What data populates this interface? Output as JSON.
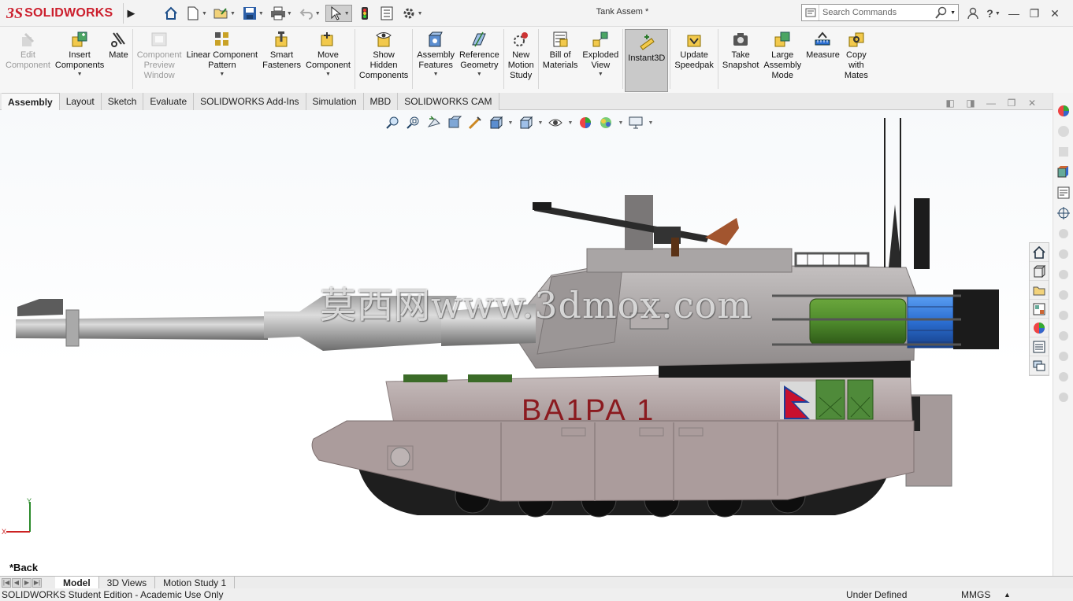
{
  "titlebar": {
    "logo_ds": "3S",
    "logo_text": "SOLIDWORKS",
    "document_title": "Tank Assem *",
    "search_placeholder": "Search Commands"
  },
  "commands": [
    {
      "id": "edit-component",
      "label": "Edit\nComponent",
      "disabled": true,
      "dropdown": false
    },
    {
      "id": "insert-components",
      "label": "Insert\nComponents",
      "disabled": false,
      "dropdown": true
    },
    {
      "id": "mate",
      "label": "Mate",
      "disabled": false,
      "dropdown": false
    },
    {
      "id": "component-preview-window",
      "label": "Component\nPreview\nWindow",
      "disabled": true,
      "dropdown": false
    },
    {
      "id": "linear-component-pattern",
      "label": "Linear Component\nPattern",
      "disabled": false,
      "dropdown": true
    },
    {
      "id": "smart-fasteners",
      "label": "Smart\nFasteners",
      "disabled": false,
      "dropdown": false
    },
    {
      "id": "move-component",
      "label": "Move\nComponent",
      "disabled": false,
      "dropdown": true
    },
    {
      "id": "show-hidden-components",
      "label": "Show\nHidden\nComponents",
      "disabled": false,
      "dropdown": false
    },
    {
      "id": "assembly-features",
      "label": "Assembly\nFeatures",
      "disabled": false,
      "dropdown": true
    },
    {
      "id": "reference-geometry",
      "label": "Reference\nGeometry",
      "disabled": false,
      "dropdown": true
    },
    {
      "id": "new-motion-study",
      "label": "New\nMotion\nStudy",
      "disabled": false,
      "dropdown": false
    },
    {
      "id": "bill-of-materials",
      "label": "Bill of\nMaterials",
      "disabled": false,
      "dropdown": false
    },
    {
      "id": "exploded-view",
      "label": "Exploded\nView",
      "disabled": false,
      "dropdown": true
    },
    {
      "id": "instant3d",
      "label": "Instant3D",
      "disabled": false,
      "dropdown": false,
      "active": true
    },
    {
      "id": "update-speedpak",
      "label": "Update\nSpeedpak",
      "disabled": false,
      "dropdown": false
    },
    {
      "id": "take-snapshot",
      "label": "Take\nSnapshot",
      "disabled": false,
      "dropdown": false
    },
    {
      "id": "large-assembly-mode",
      "label": "Large\nAssembly\nMode",
      "disabled": false,
      "dropdown": false
    },
    {
      "id": "measure",
      "label": "Measure",
      "disabled": false,
      "dropdown": false
    },
    {
      "id": "copy-with-mates",
      "label": "Copy\nwith\nMates",
      "disabled": false,
      "dropdown": false
    }
  ],
  "tabs": [
    "Assembly",
    "Layout",
    "Sketch",
    "Evaluate",
    "SOLIDWORKS Add-Ins",
    "Simulation",
    "MBD",
    "SOLIDWORKS CAM"
  ],
  "active_tab": "Assembly",
  "viewport": {
    "watermark": "莫西网www.3dmox.com",
    "tank_marking": "BA1PA 1",
    "view_label": "*Back",
    "triad_y": "Y",
    "triad_x": "X"
  },
  "bottom_tabs": [
    "Model",
    "3D Views",
    "Motion Study 1"
  ],
  "active_bottom_tab": "Model",
  "status": {
    "edition": "SOLIDWORKS Student Edition - Academic Use Only",
    "definition": "Under Defined",
    "units": "MMGS",
    "units_arrow": "▲"
  },
  "colors": {
    "brand": "#cc1f2d",
    "tank_hull": "#b9aeae",
    "tank_lower": "#a69797",
    "marking": "#8b1a1f",
    "green_drum": "#4e8a2c",
    "blue_drum": "#2b6ed1"
  }
}
